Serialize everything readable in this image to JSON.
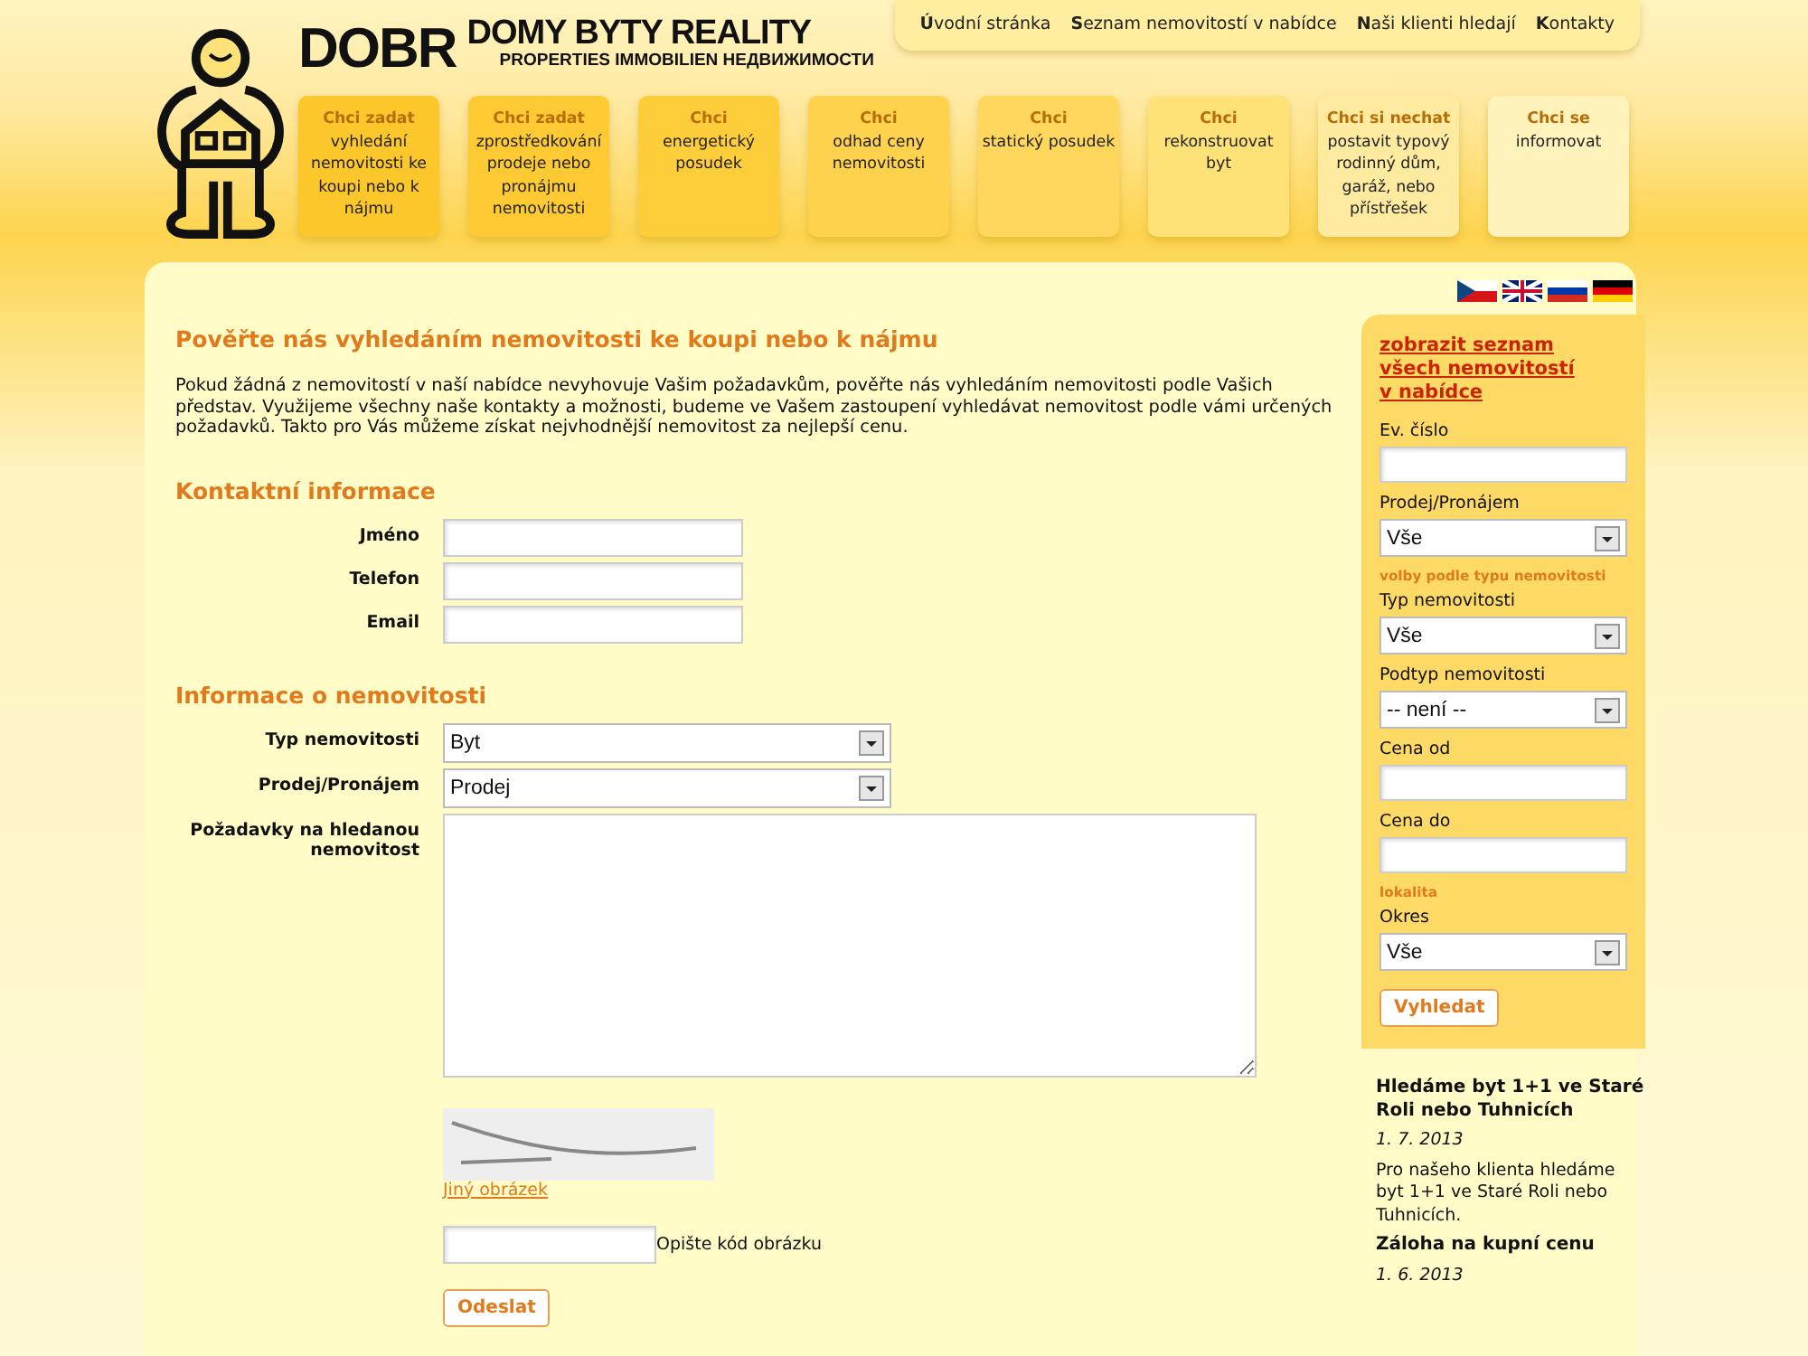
{
  "logo": {
    "brand": "DOBR",
    "tagline": "DOMY BYTY REALITY",
    "subtitle": "PROPERTIES IMMOBILIEN НЕДВИЖИМОСТИ"
  },
  "top_nav": [
    {
      "label": "**Ú**vodní stránka"
    },
    {
      "label": "**S**eznam nemovitostí v nabídce"
    },
    {
      "label": "**N**aši klienti hledají"
    },
    {
      "label": "**K**ontakty"
    }
  ],
  "tiles": [
    {
      "title": "Chci zadat",
      "text": "vyhledání nemovitosti ke koupi nebo k nájmu",
      "color": "#fcc72a"
    },
    {
      "title": "Chci zadat",
      "text": "zprostředkování prodeje nebo pronájmu nemovitosti",
      "color": "#fdca33"
    },
    {
      "title": "Chci",
      "text": "energetický posudek",
      "color": "#fdcd3a"
    },
    {
      "title": "Chci",
      "text": "odhad ceny nemovitosti",
      "color": "#fed24c"
    },
    {
      "title": "Chci",
      "text": "statický posudek",
      "color": "#fed75c"
    },
    {
      "title": "Chci",
      "text": "rekonstruovat byt",
      "color": "#fee177"
    },
    {
      "title": "Chci si nechat",
      "text": "postavit typový rodinný dům, garáž, nebo přístřešek",
      "color": "#ffeb9f"
    },
    {
      "title": "Chci se",
      "text": "informovat",
      "color": "#fff2bb"
    }
  ],
  "languages": [
    {
      "kind": "cz"
    },
    {
      "kind": "gb"
    },
    {
      "kind": "ru"
    },
    {
      "kind": "de"
    }
  ],
  "main": {
    "title": "Pověřte nás vyhledáním nemovitosti ke koupi nebo k nájmu",
    "intro": "Pokud žádná z nemovitostí v naší nabídce nevyhovuje Vašim požadavkům, pověřte nás vyhledáním nemovitosti podle Vašich představ. Využijeme všechny naše kontakty a možnosti, budeme ve Vašem zastoupení vyhledávat nemovitost podle vámi určených požadavků. Takto pro Vás můžeme získat nejvhodnější nemovitost za nejlepší cenu.",
    "sections": [
      {
        "heading": "Kontaktní informace",
        "fields": [
          {
            "label": "Jméno",
            "kind": "text"
          },
          {
            "label": "Telefon",
            "kind": "text"
          },
          {
            "label": "Email",
            "kind": "text"
          }
        ]
      },
      {
        "heading": "Informace o nemovitosti",
        "fields": [
          {
            "label": "Typ nemovitosti",
            "kind": "select",
            "value": "Byt"
          },
          {
            "label": "Prodej/Pronájem",
            "kind": "select",
            "value": "Prodej"
          },
          {
            "label": "Požadavky na hledanou nemovitost",
            "kind": "textarea"
          }
        ]
      }
    ],
    "captcha_link": "Jiný obrázek",
    "captcha_hint": "Opište kód obrázku",
    "submit": "Odeslat"
  },
  "sidebar": {
    "list_link": "zobrazit seznam všech nemovitostí v nabídce",
    "items": [
      {
        "kind": "label",
        "text": "Ev. číslo"
      },
      {
        "kind": "text"
      },
      {
        "kind": "label",
        "text": "Prodej/Pronájem"
      },
      {
        "kind": "select",
        "value": "Vše"
      },
      {
        "kind": "heading",
        "text": "volby podle typu nemovitosti"
      },
      {
        "kind": "label",
        "text": "Typ nemovitosti"
      },
      {
        "kind": "select",
        "value": "Vše"
      },
      {
        "kind": "label",
        "text": "Podtyp nemovitosti"
      },
      {
        "kind": "select",
        "value": "-- není --"
      },
      {
        "kind": "label",
        "text": "Cena od"
      },
      {
        "kind": "text"
      },
      {
        "kind": "label",
        "text": "Cena do"
      },
      {
        "kind": "text"
      },
      {
        "kind": "heading",
        "text": "lokalita"
      },
      {
        "kind": "label",
        "text": "Okres"
      },
      {
        "kind": "select",
        "value": "Vše"
      },
      {
        "kind": "button",
        "text": "Vyhledat"
      }
    ],
    "news": [
      {
        "title": "Hledáme byt 1+1 ve Staré Roli nebo Tuhnicích",
        "date": "1. 7. 2013",
        "text": "Pro našeho klienta hledáme byt 1+1 ve Staré Roli nebo Tuhnicích."
      },
      {
        "title": "Záloha na kupní cenu",
        "date": "1. 6. 2013"
      }
    ]
  }
}
